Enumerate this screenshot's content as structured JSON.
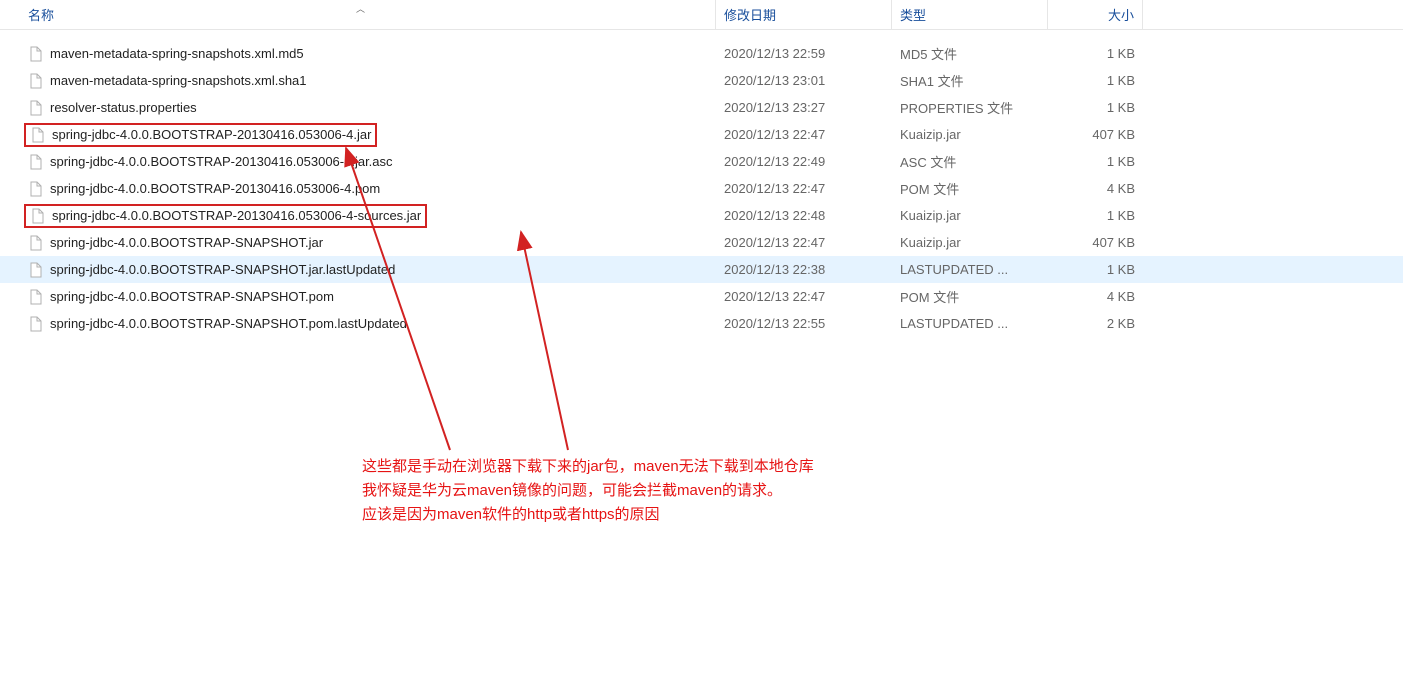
{
  "columns": {
    "name": "名称",
    "date": "修改日期",
    "type": "类型",
    "size": "大小"
  },
  "files": [
    {
      "name": "maven-metadata-spring-snapshots.xml.md5",
      "date": "2020/12/13 22:59",
      "type": "MD5 文件",
      "size": "1 KB",
      "boxed": false,
      "selected": false
    },
    {
      "name": "maven-metadata-spring-snapshots.xml.sha1",
      "date": "2020/12/13 23:01",
      "type": "SHA1 文件",
      "size": "1 KB",
      "boxed": false,
      "selected": false
    },
    {
      "name": "resolver-status.properties",
      "date": "2020/12/13 23:27",
      "type": "PROPERTIES 文件",
      "size": "1 KB",
      "boxed": false,
      "selected": false
    },
    {
      "name": "spring-jdbc-4.0.0.BOOTSTRAP-20130416.053006-4.jar",
      "date": "2020/12/13 22:47",
      "type": "Kuaizip.jar",
      "size": "407 KB",
      "boxed": true,
      "selected": false
    },
    {
      "name": "spring-jdbc-4.0.0.BOOTSTRAP-20130416.053006-4.jar.asc",
      "date": "2020/12/13 22:49",
      "type": "ASC 文件",
      "size": "1 KB",
      "boxed": false,
      "selected": false
    },
    {
      "name": "spring-jdbc-4.0.0.BOOTSTRAP-20130416.053006-4.pom",
      "date": "2020/12/13 22:47",
      "type": "POM 文件",
      "size": "4 KB",
      "boxed": false,
      "selected": false
    },
    {
      "name": "spring-jdbc-4.0.0.BOOTSTRAP-20130416.053006-4-sources.jar",
      "date": "2020/12/13 22:48",
      "type": "Kuaizip.jar",
      "size": "1 KB",
      "boxed": true,
      "selected": false
    },
    {
      "name": "spring-jdbc-4.0.0.BOOTSTRAP-SNAPSHOT.jar",
      "date": "2020/12/13 22:47",
      "type": "Kuaizip.jar",
      "size": "407 KB",
      "boxed": false,
      "selected": false
    },
    {
      "name": "spring-jdbc-4.0.0.BOOTSTRAP-SNAPSHOT.jar.lastUpdated",
      "date": "2020/12/13 22:38",
      "type": "LASTUPDATED ...",
      "size": "1 KB",
      "boxed": false,
      "selected": true
    },
    {
      "name": "spring-jdbc-4.0.0.BOOTSTRAP-SNAPSHOT.pom",
      "date": "2020/12/13 22:47",
      "type": "POM 文件",
      "size": "4 KB",
      "boxed": false,
      "selected": false
    },
    {
      "name": "spring-jdbc-4.0.0.BOOTSTRAP-SNAPSHOT.pom.lastUpdated",
      "date": "2020/12/13 22:55",
      "type": "LASTUPDATED ...",
      "size": "2 KB",
      "boxed": false,
      "selected": false
    }
  ],
  "annotation": {
    "line1": "这些都是手动在浏览器下载下来的jar包，maven无法下载到本地仓库",
    "line2": "我怀疑是华为云maven镜像的问题，可能会拦截maven的请求。",
    "line3": "应该是因为maven软件的http或者https的原因"
  }
}
